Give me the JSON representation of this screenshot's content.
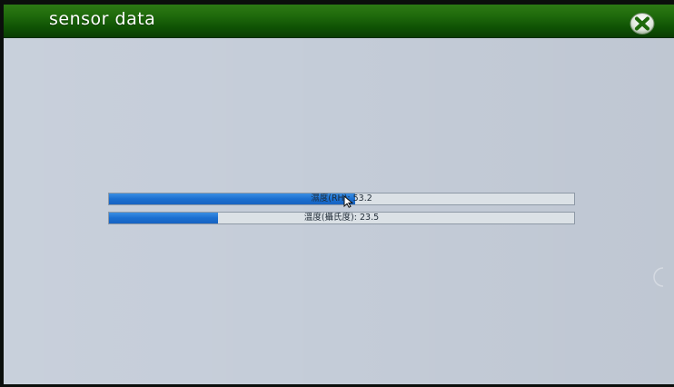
{
  "window": {
    "title": "sensor data",
    "close_icon": "close-x-circle-icon"
  },
  "colors": {
    "titlebar": "#1f6a0c",
    "progress_fill": "#1b6fd0",
    "progress_track": "#dbe1e6",
    "background": "#c5cdd9"
  },
  "sensors": [
    {
      "label": "濕度(RH): 53.2",
      "progress_fraction": 0.53
    },
    {
      "label": "溫度(攝氏度): 23.5",
      "progress_fraction": 0.235
    }
  ]
}
